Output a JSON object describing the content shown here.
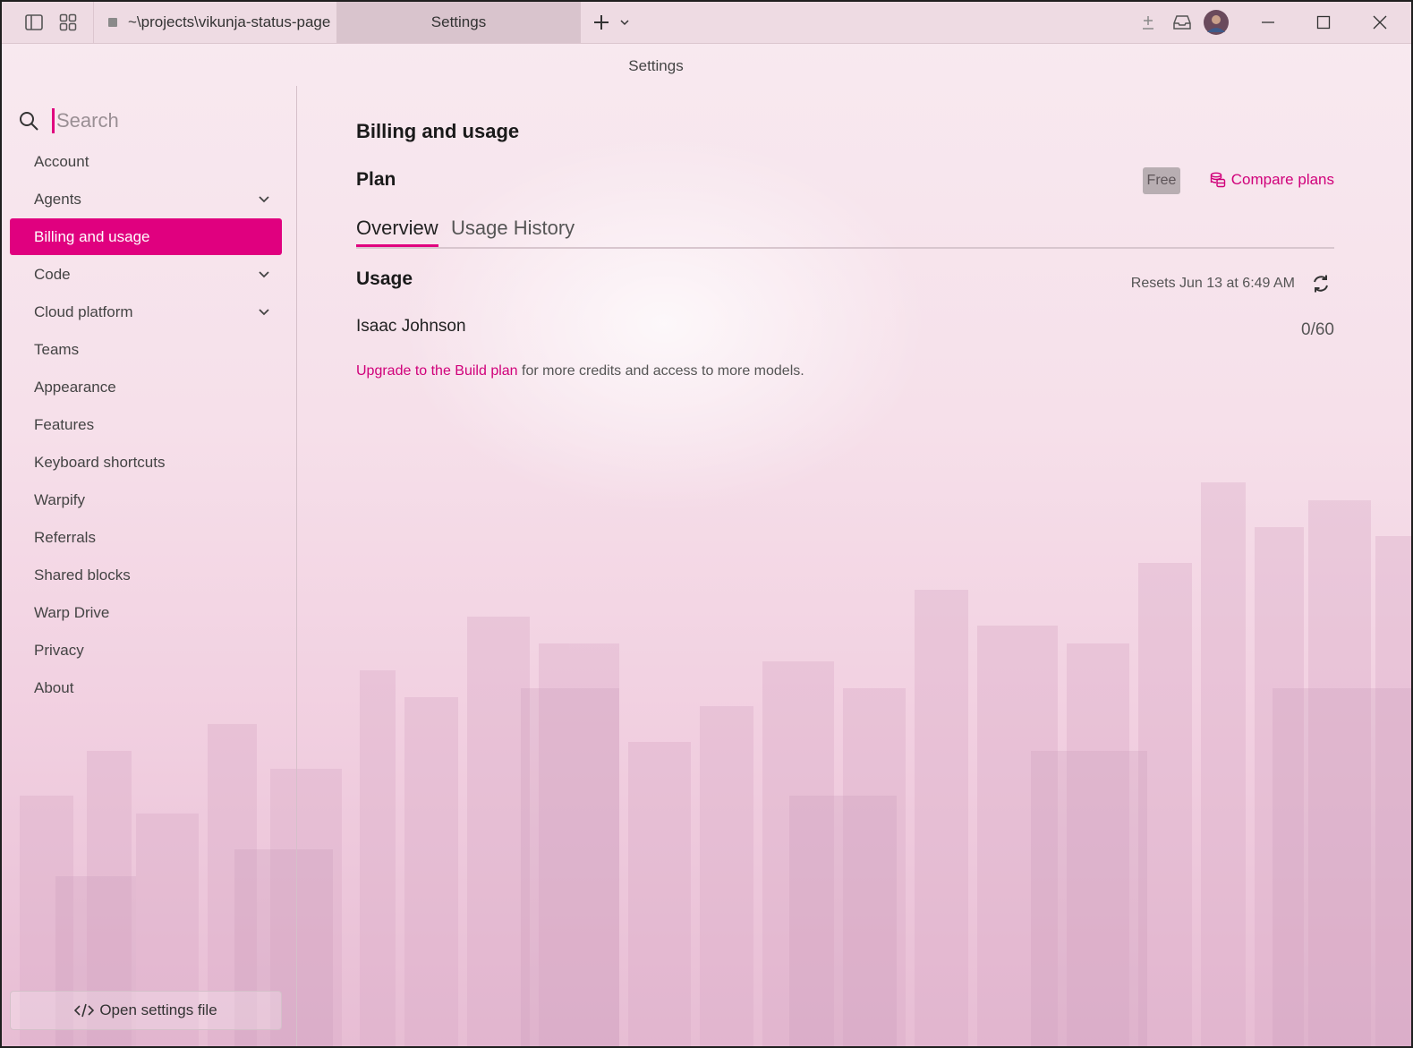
{
  "titlebar": {
    "tabs": [
      {
        "label": "~\\projects\\vikunja-status-page",
        "active": false
      },
      {
        "label": "Settings",
        "active": true
      }
    ],
    "icons": [
      "sidebar-toggle-icon",
      "grid-icon",
      "plus-icon",
      "chevron-down-icon",
      "pin-icon",
      "inbox-icon",
      "avatar",
      "minimize-icon",
      "maximize-icon",
      "close-icon"
    ]
  },
  "window_title": "Settings",
  "sidebar": {
    "search_placeholder": "Search",
    "items": [
      {
        "label": "Account",
        "expandable": false,
        "active": false
      },
      {
        "label": "Agents",
        "expandable": true,
        "active": false
      },
      {
        "label": "Billing and usage",
        "expandable": false,
        "active": true
      },
      {
        "label": "Code",
        "expandable": true,
        "active": false
      },
      {
        "label": "Cloud platform",
        "expandable": true,
        "active": false
      },
      {
        "label": "Teams",
        "expandable": false,
        "active": false
      },
      {
        "label": "Appearance",
        "expandable": false,
        "active": false
      },
      {
        "label": "Features",
        "expandable": false,
        "active": false
      },
      {
        "label": "Keyboard shortcuts",
        "expandable": false,
        "active": false
      },
      {
        "label": "Warpify",
        "expandable": false,
        "active": false
      },
      {
        "label": "Referrals",
        "expandable": false,
        "active": false
      },
      {
        "label": "Shared blocks",
        "expandable": false,
        "active": false
      },
      {
        "label": "Warp Drive",
        "expandable": false,
        "active": false
      },
      {
        "label": "Privacy",
        "expandable": false,
        "active": false
      },
      {
        "label": "About",
        "expandable": false,
        "active": false
      }
    ],
    "open_settings_label": "Open settings file"
  },
  "main": {
    "title": "Billing and usage",
    "plan_heading": "Plan",
    "plan_badge": "Free",
    "compare_plans": "Compare plans",
    "tabs": [
      "Overview",
      "Usage History"
    ],
    "active_tab": "Overview",
    "usage": {
      "heading": "Usage",
      "resets": "Resets Jun 13 at 6:49 AM",
      "user": "Isaac Johnson",
      "count": "0/60"
    },
    "upgrade_link": "Upgrade to the Build plan",
    "upgrade_rest": " for more credits and access to more models."
  },
  "colors": {
    "accent": "#e0007f",
    "link": "#d0007a",
    "badge_bg": "#b8aeb2"
  }
}
